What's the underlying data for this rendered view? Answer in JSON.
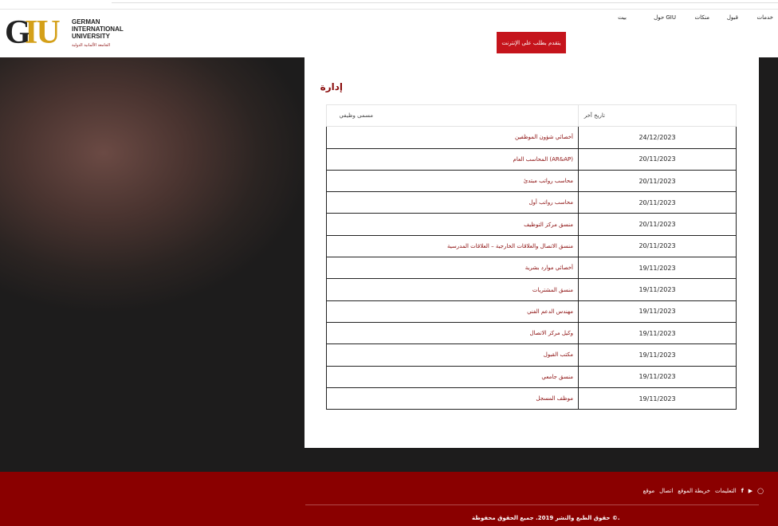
{
  "logo": {
    "mark_g": "G",
    "mark_iu": "IU",
    "line1": "GERMAN",
    "line2": "INTERNATIONAL",
    "line3": "UNIVERSITY",
    "arabic": "الجامعة الألمانية الدولية"
  },
  "nav": {
    "items": [
      "خدمات",
      "قبول",
      "منكات",
      "حول GIU",
      "بيت"
    ]
  },
  "apply_button": "يتقدم بطلب على الإنترنت",
  "page_title": "إدارة",
  "table": {
    "headers": {
      "date": "تاريخ آخر",
      "title": "مسمى وظيفي"
    },
    "rows": [
      {
        "date": "24/12/2023",
        "title": "أخصائي شؤون الموظفين"
      },
      {
        "date": "20/11/2023",
        "title": "المحاسب العام (AR&AP)"
      },
      {
        "date": "20/11/2023",
        "title": "محاسب رواتب مبتدئ"
      },
      {
        "date": "20/11/2023",
        "title": "محاسب رواتب أول"
      },
      {
        "date": "20/11/2023",
        "title": "منسق مركز التوظيف"
      },
      {
        "date": "20/11/2023",
        "title": "منسق الاتصال والعلاقات الخارجية – العلاقات المدرسية"
      },
      {
        "date": "19/11/2023",
        "title": "أخصائي موارد بشرية"
      },
      {
        "date": "19/11/2023",
        "title": "منسق المشتريات"
      },
      {
        "date": "19/11/2023",
        "title": "مهندس الدعم الفني"
      },
      {
        "date": "19/11/2023",
        "title": "وكيل مركز الاتصال"
      },
      {
        "date": "19/11/2023",
        "title": "مكتب القبول"
      },
      {
        "date": "19/11/2023",
        "title": "منسق جامعي"
      },
      {
        "date": "19/11/2023",
        "title": "موظف المسجل"
      }
    ]
  },
  "footer": {
    "links": [
      "التعليمات",
      "خريطة الموقع",
      "اتصال",
      "موقع"
    ],
    "icons": [
      "instagram-icon",
      "youtube-icon",
      "facebook-icon"
    ],
    "copyright": "حقوق الطبع والنشر 2019. جميع الحقوق محفوظة ©."
  },
  "colors": {
    "brand_red": "#8a0000",
    "button_red": "#c5141c",
    "logo_gold": "#d4a019"
  }
}
